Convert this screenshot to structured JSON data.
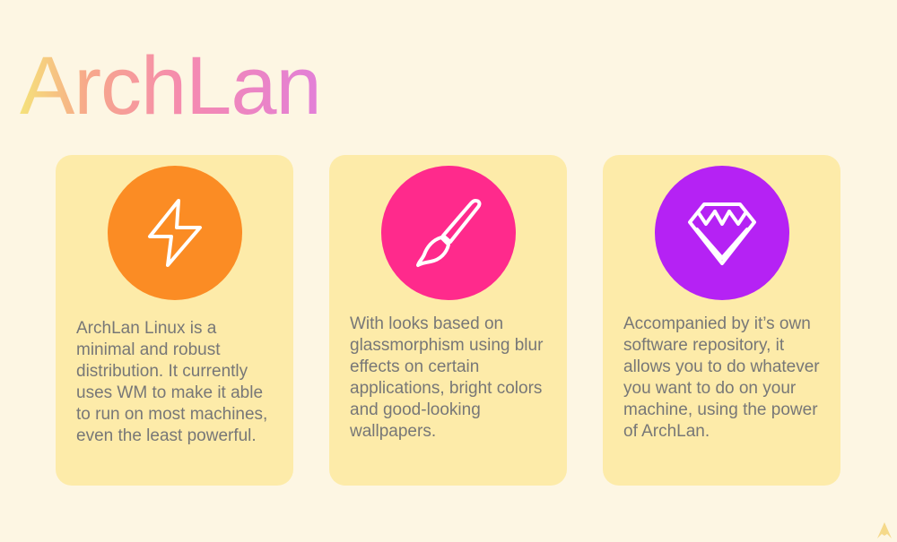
{
  "app": {
    "title": "ArchLan"
  },
  "colors": {
    "background": "#fdf6e3",
    "card": "#fdeba9",
    "text": "#777777",
    "performance_accent": "#fb8c24",
    "design_accent": "#ff2a8c",
    "software_accent": "#b522f4"
  },
  "cards": [
    {
      "icon": "lightning-bolt-icon",
      "text": "ArchLan Linux is a minimal and robust distribution. It currently uses WM to make it able to run on most machines, even the least powerful."
    },
    {
      "icon": "paintbrush-icon",
      "text": "With looks based on glassmorphism using blur effects on certain applications, bright colors and good-looking wallpapers."
    },
    {
      "icon": "gem-icon",
      "text": "Accompanied by it’s own software repository, it allows you to do whatever you want to do on your machine, using the power of ArchLan."
    }
  ],
  "footer": {
    "logo": "archlan-logo-icon"
  }
}
